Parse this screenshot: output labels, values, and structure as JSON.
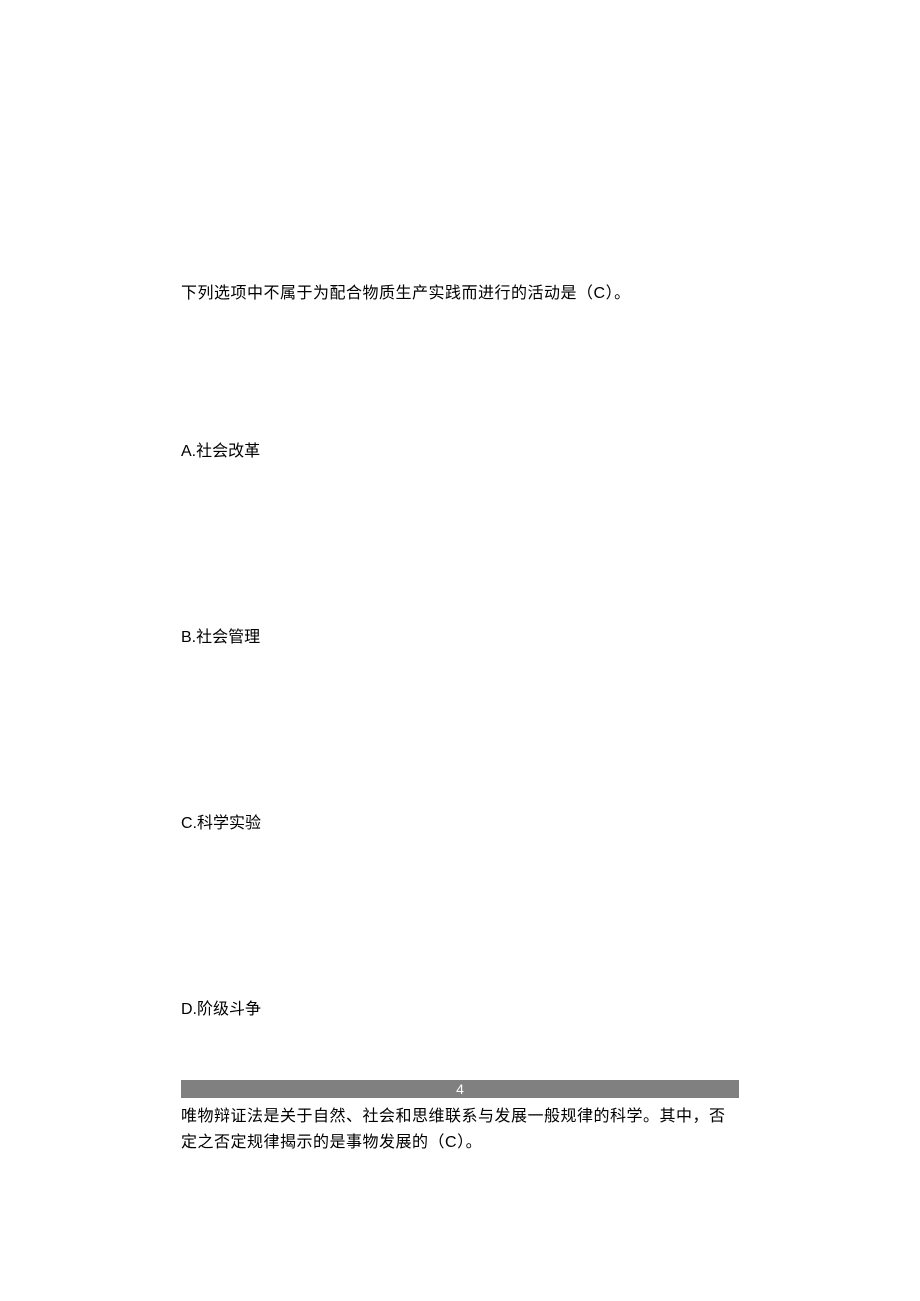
{
  "question3": {
    "text_part1": "下列选项中不属于为配合物质生产实践而进行的活动是（",
    "answer": "C",
    "text_part2": "）。",
    "options": {
      "a": {
        "prefix": "A.",
        "text": "社会改革"
      },
      "b": {
        "prefix": "B.",
        "text": "社会管理"
      },
      "c": {
        "prefix": "C.",
        "text": "科学实验"
      },
      "d": {
        "prefix": "D.",
        "text": "阶级斗争"
      }
    }
  },
  "divider": {
    "number": "4"
  },
  "question4": {
    "text_part1": "唯物辩证法是关于自然、社会和思维联系与发展一般规律的科学。其中，否定之否定规律揭示的是事物发展的（",
    "answer": "C",
    "text_part2": "）。"
  }
}
